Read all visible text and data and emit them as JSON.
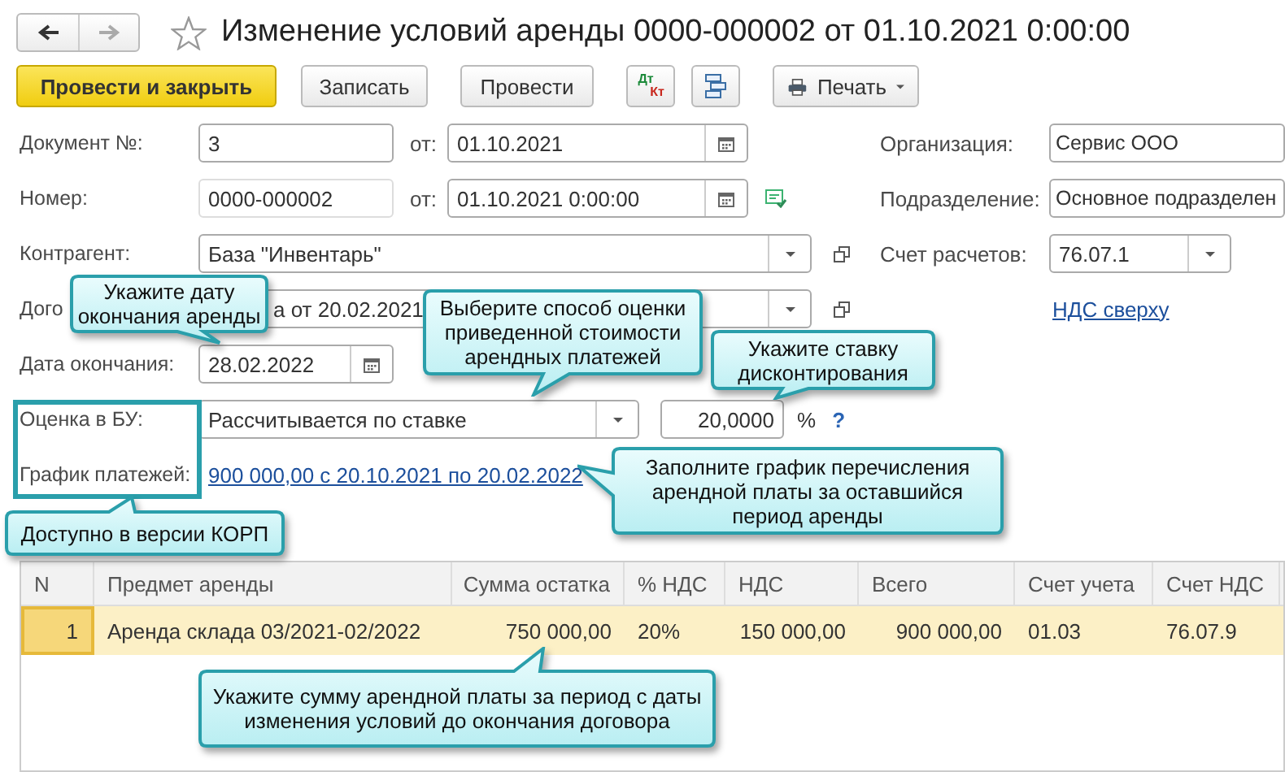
{
  "window": {
    "title": "Изменение условий аренды 0000-000002 от 01.10.2021 0:00:00"
  },
  "toolbar": [
    {
      "kind": "primary",
      "label": "Провести и закрыть"
    },
    {
      "kind": "plain",
      "label": "Записать"
    },
    {
      "kind": "plain",
      "label": "Провести"
    },
    {
      "kind": "dtkt",
      "label": "Дт",
      "label2": "Кт"
    },
    {
      "kind": "structure"
    },
    {
      "kind": "menu",
      "label": "Печать"
    }
  ],
  "form": [
    {
      "label": "Документ №:",
      "field": {
        "kind": "text",
        "value": "3"
      },
      "date_label": "от:",
      "date": "01.10.2021",
      "right": {
        "label": "Организация:",
        "field": "Сервис ООО"
      }
    },
    {
      "label": "Номер:",
      "field": {
        "kind": "readonly",
        "value": "0000-000002"
      },
      "date_label": "от:",
      "date": "01.10.2021  0:00:00",
      "posted": true,
      "right": {
        "label": "Подразделение:",
        "field": "Основное подразделен"
      }
    },
    {
      "label": "Контрагент:",
      "field": {
        "kind": "ref",
        "value": "База \"Инвентарь\""
      },
      "right": {
        "label": "Счет расчетов:",
        "field": "76.07.1",
        "dropdown": true
      }
    },
    {
      "label": "Дого",
      "field": {
        "kind": "ref-covered",
        "value": "а от 20.02.2021"
      },
      "right": {
        "link": "НДС сверху"
      }
    },
    {
      "label": "Дата окончания:",
      "field": {
        "kind": "date",
        "value": "28.02.2022"
      }
    },
    {
      "label": "Оценка в БУ:",
      "field": {
        "kind": "select",
        "value": "Рассчитывается по ставке"
      },
      "rate": "20,0000",
      "unit": "%",
      "help": "?"
    },
    {
      "label": "График платежей:",
      "field": {
        "kind": "link",
        "value": "900 000,00 с 20.10.2021 по 20.02.2022"
      }
    }
  ],
  "table": {
    "columns": [
      {
        "label": "N",
        "kind": "number"
      },
      {
        "label": "Предмет аренды",
        "kind": "text"
      },
      {
        "label": "Сумма остатка",
        "kind": "number"
      },
      {
        "label": "% НДС",
        "kind": "text"
      },
      {
        "label": "НДС",
        "kind": "number"
      },
      {
        "label": "Всего",
        "kind": "number"
      },
      {
        "label": "Счет учета",
        "kind": "text"
      },
      {
        "label": "Счет НДС",
        "kind": "text"
      }
    ],
    "rows": [
      {
        "selected": true,
        "cells": [
          "1",
          "Аренда склада 03/2021-02/2022",
          "750 000,00",
          "20%",
          "150 000,00",
          "900 000,00",
          "01.03",
          "76.07.9"
        ]
      }
    ]
  },
  "callouts": [
    {
      "text": "Укажите дату окончания аренды"
    },
    {
      "text": "Выберите способ оценки приведенной стоимости арендных платежей"
    },
    {
      "text": "Укажите ставку дисконтирования"
    },
    {
      "text": "Заполните график перечисления арендной платы за оставшийся период аренды"
    },
    {
      "text": "Доступно в версии КОРП"
    },
    {
      "text": "Укажите сумму арендной платы за период с даты изменения условий до окончания договора"
    }
  ]
}
